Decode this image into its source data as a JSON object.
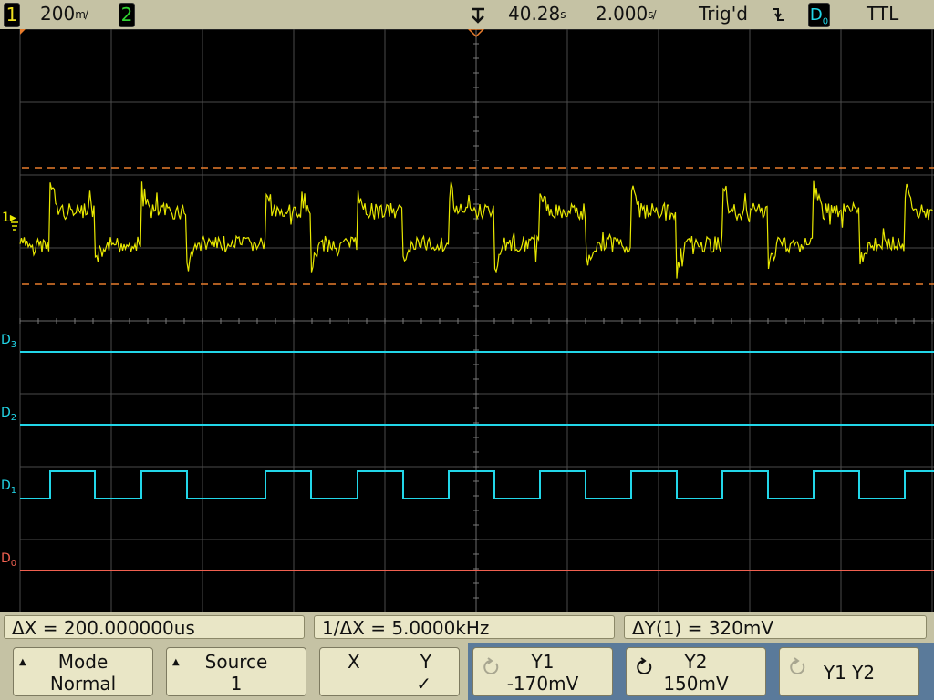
{
  "status_bar": {
    "ch1_number": "1",
    "ch1_scale_value": "200",
    "ch1_scale_unit": "m/",
    "ch2_number": "2",
    "trigger_position_value": "40.28",
    "trigger_position_unit": "s",
    "timebase_value": "2.000",
    "timebase_unit": "s/",
    "trigger_status": "Trig'd",
    "trigger_slope_icon": "falling-edge-icon",
    "trigger_source": "D0",
    "trigger_level_mode": "TTL"
  },
  "display": {
    "channel_labels": {
      "ch1": "1",
      "d3": "D",
      "d3_sub": "3",
      "d2": "D",
      "d2_sub": "2",
      "d1": "D",
      "d1_sub": "1",
      "d0": "D",
      "d0_sub": "0"
    },
    "colors": {
      "analog": "#e8e800",
      "digital": "#22d6e8",
      "d0": "#f06050",
      "cursor": "#e87c2c",
      "grid": "#505050"
    }
  },
  "measurements": {
    "delta_x": "ΔX = 200.000000us",
    "inverse_delta_x": "1/ΔX = 5.0000kHz",
    "delta_y": "ΔY(1) = 320mV"
  },
  "softkeys": {
    "mode": {
      "line1": "Mode",
      "line2": "Normal"
    },
    "source": {
      "line1": "Source",
      "line2": "1"
    },
    "xy": {
      "x_label": "X",
      "y_label": "Y",
      "check": "✓"
    },
    "y1": {
      "line1": "Y1",
      "line2": "-170mV"
    },
    "y2": {
      "line1": "Y2",
      "line2": "150mV"
    },
    "y1y2": {
      "line1": "Y1 Y2"
    }
  }
}
